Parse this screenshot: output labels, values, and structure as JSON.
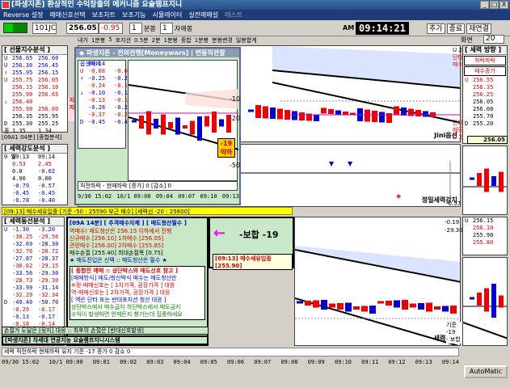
{
  "window": {
    "title": "[파생지존] 환상적인 수익창출의 메커니즘 요술램프지니",
    "buttons": [
      "_",
      "□",
      "X"
    ]
  },
  "menu": [
    "Reverse 설정",
    "매매신호선택",
    "보조차트",
    "보조기능",
    "시뮬레이터",
    "실전매매설",
    "테스트"
  ],
  "toolbar": {
    "code": "101JC",
    "price": "256.05",
    "change": "-0.95",
    "bun_value": "1",
    "bun_label": "분봉",
    "ja_value": "1",
    "ja_label": "자애봉",
    "clock_prefix": "AM",
    "clock": "09:14:21",
    "buttons": [
      "추가",
      "종료",
      "재연결"
    ],
    "zoom_label": "화면",
    "zoom_value": "20"
  },
  "subtabs": [
    "내가",
    "1분봉",
    "5",
    "포지션",
    "0.5분",
    "2분",
    "1분봉",
    "종합",
    "1분봉",
    "분봉변경",
    "일봉합계"
  ],
  "left_top": {
    "header": "[ 선물지수분석 ]",
    "rows": [
      {
        "a": "U",
        "b": "256.65",
        "c": "256.60"
      },
      {
        "a": "U",
        "b": "256.30",
        "c": "256.45"
      },
      {
        "a": "↑",
        "b": "255.95",
        "c": "256.15"
      },
      {
        "a": "U",
        "b": "255.75",
        "c": "256.05"
      },
      {
        "a": "",
        "b": "256.15",
        "c": "256.10"
      },
      {
        "a": "",
        "b": "255.90",
        "c": "256.65"
      },
      {
        "a": "↓",
        "b": "256.40",
        "c": ""
      },
      {
        "a": "",
        "b": "255.90",
        "c": "256.00"
      },
      {
        "a": "",
        "b": "256.35",
        "c": "255.95"
      },
      {
        "a": "D",
        "b": "255.30",
        "c": "255.25"
      },
      {
        "a": "종",
        "b": "1.35",
        "c": "1.34"
      }
    ],
    "side_tag": "지지",
    "time_row": "[09A1 04분]  [종합분석]",
    "sub_header": "[ 세력강도분석 ]",
    "sub_rows": [
      {
        "a": "0 일",
        "b": "09:13",
        "c": "09:14"
      },
      {
        "a": "",
        "b": "0.53",
        "c": "2.45"
      },
      {
        "a": "",
        "b": "0.0",
        "c": "-0.02"
      },
      {
        "a": "",
        "b": "4.90",
        "c": "0.00"
      },
      {
        "a": "",
        "b": "-0.79",
        "c": "-0.57"
      },
      {
        "a": "",
        "b": "-0.45",
        "c": "-0.45"
      },
      {
        "a": "",
        "b": "-0.78",
        "c": "-0.40"
      }
    ]
  },
  "left_mid": {
    "status_bar": "[09:13] 매수세유입중 [기준 -50 : 25590 부근 매수]  [세력선 -20 : 25600]",
    "header": "[ 세력동선분석 ]",
    "rows": [
      {
        "a": "U",
        "b": "-1.30",
        "c": "-3.20"
      },
      {
        "a": "",
        "b": "-30.25",
        "c": "-29.56"
      },
      {
        "a": "",
        "b": "-32.69",
        "c": "-28.30"
      },
      {
        "a": "",
        "b": "-32.76",
        "c": "-28.72"
      },
      {
        "a": "",
        "b": "-27.87",
        "c": "-28.37"
      },
      {
        "a": "",
        "b": "-30.62",
        "c": "-29.15"
      },
      {
        "a": "",
        "b": "-33.56",
        "c": "-29.30"
      },
      {
        "a": "",
        "b": "-28.73",
        "c": "-29.30"
      },
      {
        "a": "",
        "b": "-33.99",
        "c": "-31.14"
      },
      {
        "a": "",
        "b": "-32.29",
        "c": "-32.34"
      },
      {
        "a": "D",
        "b": "-49.40",
        "c": "-50.70"
      },
      {
        "a": "",
        "b": "-0.29",
        "c": "-0.17"
      },
      {
        "a": "",
        "b": "-0.13",
        "c": "-0.17"
      },
      {
        "a": "",
        "b": "-0.18",
        "c": "-0.14"
      },
      {
        "a": "",
        "b": "-0.17",
        "c": "-0.15"
      }
    ]
  },
  "bottom_left_strip": "세력 | 직전하락 | 현재하락 유지  기준 -17  증가 0",
  "center_info": {
    "head": "[09A 14분] [ 추격매수자제 ] [ 매도청산필수 ]",
    "lines": [
      "역매수! 매도청산은 256.15 이하에서 진행",
      "신규매수 [256.10]   1차매수 [256.05]",
      "관망매수 [256.00]   2차매수 [255.85]",
      "매수손절 [255.40]   최대손절폭 [0.75]",
      "★ 매도진입은 신택 :: 매도청산은 필수 ★"
    ],
    "box_title": "[ 종합전 매매 :: 상단박스와 매도신호 참고 ]",
    "box_lines": [
      "[매매방식] 매도/청산박식 매수는 매도청산만",
      "※정-매매신호는 [ 1차가격, 권장가격 ] 대응",
      "역-매매신호는 [ 2차가격, 권장가격 ] 대응",
      "[ 역은 단타 또는 반대포지션 청산 대응 ]",
      "상단박스에서 매수급지 하단박스에서 매도금지",
      "수익이 발생하면 언제든지 챙기는데 집중하세요"
    ],
    "footer1": "손절가 도달은 [뒷지] 대응 :: 최후의 손절은 [반대신호발생]",
    "footer2": "[파생지존] 차세대 연공지능 요술램프지니시스템"
  },
  "signal_box": {
    "arrow_text": "-보합 -19",
    "status": "[09:13] 매수세유입중 [255.90]"
  },
  "popup": {
    "title": "◆ 파생지존 - 전의전쟁[Moneywars] | 변동적관찰[Starwars]",
    "rows": [
      {
        "label": "옵션매매",
        "v1": "09:14",
        "v2": ""
      },
      {
        "label": "U",
        "v1": "-0.08",
        "v2": "-0.08"
      },
      {
        "label": "↑",
        "v1": "-0.25",
        "v2": "-0.25"
      },
      {
        "label": "",
        "v1": "-0.24",
        "v2": "-0.15"
      },
      {
        "label": "↓",
        "v1": "-0.10",
        "v2": "-0.10"
      },
      {
        "label": "",
        "v1": "-0.13",
        "v2": "-0.13"
      },
      {
        "label": "",
        "v1": "-0.28",
        "v2": "-0.27"
      },
      {
        "label": "",
        "v1": "-0.37",
        "v2": "-0.22"
      },
      {
        "label": "D",
        "v1": "-0.45",
        "v2": "-0.45"
      }
    ],
    "tag_line1": "-19",
    "tag_line2": "약하",
    "footer": "직전하락 - 현재하락 [증가]  0  [감소]  0",
    "times": [
      "9/30 15:02",
      "10/1 09:00",
      "09:04",
      "09:07",
      "09:10",
      "09:13"
    ],
    "axis_labels": [
      "-10",
      "-20",
      "-50"
    ]
  },
  "right_panel": {
    "header": "[ 세력 방향 ]",
    "badge": "하락하락",
    "badge2": "매수증가",
    "rows": [
      {
        "a": "U",
        "b": "256.55"
      },
      {
        "a": "",
        "b": "256.35"
      },
      {
        "a": "",
        "b": "256.25"
      },
      {
        "a": "",
        "b": "256.05"
      },
      {
        "a": "",
        "b": "256.00"
      },
      {
        "a": "",
        "b": "255.70"
      },
      {
        "a": "D",
        "b": "255.20"
      }
    ],
    "side_labels": [
      "주",
      "세",
      "력",
      "감"
    ],
    "price_tag": "256.05",
    "top_values": [
      "U 256.55",
      "단타진행",
      "매수도체"
    ],
    "mid_values": [
      "단타진행",
      "매도도체",
      "D 255.30"
    ]
  },
  "right_mid": {
    "values": [
      "-0.19",
      "-29.30",
      "-0.57"
    ],
    "label": "정밀세력강지",
    "rows": [
      {
        "a": "U",
        "b": "256.15"
      },
      {
        "a": "",
        "b": "256.10"
      },
      {
        "a": "",
        "b": "255.90"
      },
      {
        "a": "",
        "b": "255.80"
      }
    ],
    "tag1": "기준",
    "tag2": "-19",
    "tag3": "- 보합",
    "label2": "세력분석",
    "auto": "AutoMatic"
  },
  "chart1_label": "Jini옵션",
  "chart2_label": "정밀세력강지",
  "chart3_label": "세력분석",
  "axis_ticks": [
    "09/30 15:02",
    "10/1 09:00",
    "09:01",
    "09:02",
    "09:03",
    "09:04",
    "09:05",
    "09:06",
    "09:07",
    "09:08",
    "09:09",
    "09:10",
    "09:11",
    "09:12",
    "09:13",
    "09:14"
  ],
  "statusbar_bottom": "세력 직전하락 현재하락 유지  기준 -17  증가 0  감소 0"
}
